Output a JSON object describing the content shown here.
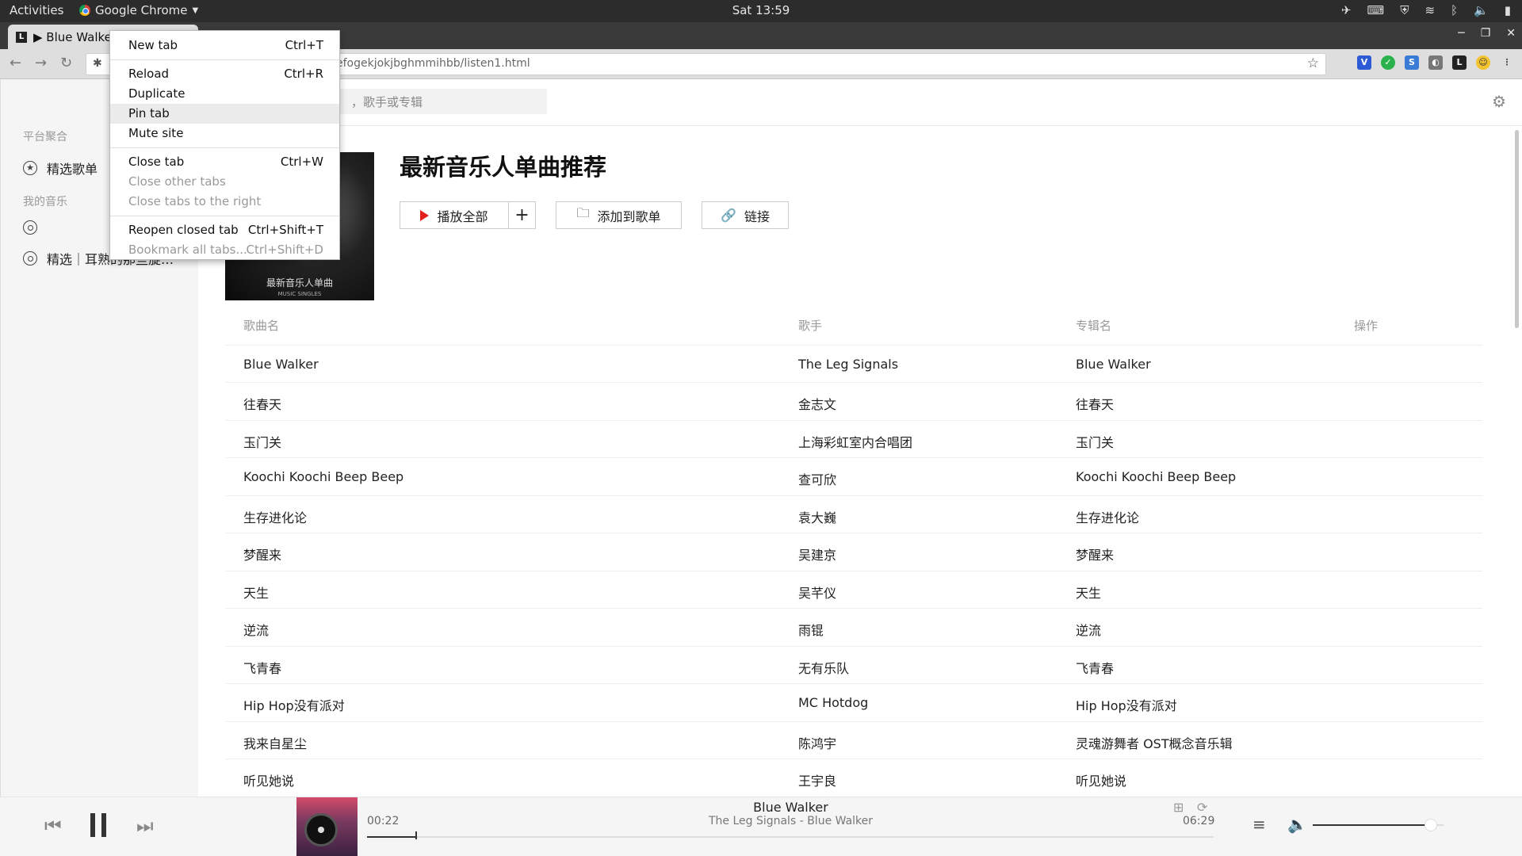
{
  "system": {
    "activities": "Activities",
    "app_name": "Google Chrome",
    "clock": "Sat 13:59"
  },
  "browser": {
    "tab_title": "▶ Blue Walker",
    "tab_favicon": "L",
    "url_visible": "efogekjokjbghmmihbb/listen1.html"
  },
  "context_menu": {
    "items": [
      {
        "label": "New tab",
        "shortcut": "Ctrl+T"
      },
      {
        "label": "Reload",
        "shortcut": "Ctrl+R"
      },
      {
        "label": "Duplicate",
        "shortcut": ""
      },
      {
        "label": "Pin tab",
        "shortcut": ""
      },
      {
        "label": "Mute site",
        "shortcut": ""
      },
      {
        "label": "Close tab",
        "shortcut": "Ctrl+W"
      },
      {
        "label": "Close other tabs",
        "shortcut": ""
      },
      {
        "label": "Close tabs to the right",
        "shortcut": ""
      },
      {
        "label": "Reopen closed tab",
        "shortcut": "Ctrl+Shift+T"
      },
      {
        "label": "Bookmark all tabs...",
        "shortcut": "Ctrl+Shift+D"
      }
    ]
  },
  "sidebar": {
    "section1_title": "平台聚合",
    "item_featured": "精选歌单",
    "section2_title": "我的音乐",
    "item_mymusic": "精选｜耳熟的那些旋…"
  },
  "search": {
    "placeholder": "，歌手或专辑"
  },
  "playlist": {
    "title": "最新音乐人单曲推荐",
    "cover_text": "最新音乐人单曲",
    "cover_sub": "MUSIC SINGLES",
    "play_all": "播放全部",
    "add_icon": "+",
    "add_to_playlist": "添加到歌单",
    "link": "链接"
  },
  "table": {
    "headers": {
      "song": "歌曲名",
      "artist": "歌手",
      "album": "专辑名",
      "action": "操作"
    },
    "rows": [
      {
        "song": "Blue Walker",
        "artist": "The Leg Signals",
        "album": "Blue Walker"
      },
      {
        "song": "往春天",
        "artist": "金志文",
        "album": "往春天"
      },
      {
        "song": "玉门关",
        "artist": "上海彩虹室内合唱团",
        "album": "玉门关"
      },
      {
        "song": "Koochi Koochi Beep Beep",
        "artist": "查可欣",
        "album": "Koochi Koochi Beep Beep"
      },
      {
        "song": "生存进化论",
        "artist": "袁大巍",
        "album": "生存进化论"
      },
      {
        "song": "梦醒来",
        "artist": "吴建京",
        "album": "梦醒来"
      },
      {
        "song": "天生",
        "artist": "吴芊仪",
        "album": "天生"
      },
      {
        "song": "逆流",
        "artist": "雨锟",
        "album": "逆流"
      },
      {
        "song": "飞青春",
        "artist": "无有乐队",
        "album": "飞青春"
      },
      {
        "song": "Hip Hop没有派对",
        "artist": "MC Hotdog",
        "album": "Hip Hop没有派对"
      },
      {
        "song": "我来自星尘",
        "artist": "陈鸿宇",
        "album": "灵魂游舞者 OST概念音乐辑"
      },
      {
        "song": "听见她说",
        "artist": "王宇良",
        "album": "听见她说"
      }
    ]
  },
  "player": {
    "title": "Blue Walker",
    "subtitle": "The Leg Signals - Blue Walker",
    "current_time": "00:22",
    "duration": "06:29",
    "progress": 0.057,
    "volume": 0.9
  }
}
